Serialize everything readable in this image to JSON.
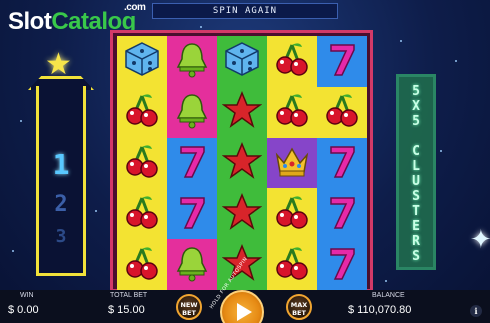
{
  "logo": {
    "slot": "Slot",
    "catalog": "Catalog",
    "com": ".com"
  },
  "banner": {
    "text": "SPIN AGAIN"
  },
  "levels": [
    "1",
    "2",
    "3"
  ],
  "cluster_label": [
    "5",
    "X",
    "5",
    " ",
    "C",
    "L",
    "U",
    "S",
    "T",
    "E",
    "R",
    "S"
  ],
  "grid": [
    [
      {
        "symbol": "dice-icon",
        "bg": "yellow"
      },
      {
        "symbol": "bell-icon",
        "bg": "pink"
      },
      {
        "symbol": "dice-icon",
        "bg": "green"
      },
      {
        "symbol": "cherry-icon",
        "bg": "yellow"
      },
      {
        "symbol": "seven-icon",
        "bg": "blue"
      }
    ],
    [
      {
        "symbol": "cherry-icon",
        "bg": "yellow"
      },
      {
        "symbol": "bell-icon",
        "bg": "pink"
      },
      {
        "symbol": "star-icon",
        "bg": "green"
      },
      {
        "symbol": "cherry-icon",
        "bg": "yellow"
      },
      {
        "symbol": "cherry-icon",
        "bg": "yellow"
      }
    ],
    [
      {
        "symbol": "cherry-icon",
        "bg": "yellow"
      },
      {
        "symbol": "seven-icon",
        "bg": "blue"
      },
      {
        "symbol": "star-icon",
        "bg": "green"
      },
      {
        "symbol": "crown-icon",
        "bg": "purple"
      },
      {
        "symbol": "seven-icon",
        "bg": "blue"
      }
    ],
    [
      {
        "symbol": "cherry-icon",
        "bg": "yellow"
      },
      {
        "symbol": "seven-icon",
        "bg": "blue"
      },
      {
        "symbol": "star-icon",
        "bg": "green"
      },
      {
        "symbol": "cherry-icon",
        "bg": "yellow"
      },
      {
        "symbol": "seven-icon",
        "bg": "blue"
      }
    ],
    [
      {
        "symbol": "cherry-icon",
        "bg": "yellow"
      },
      {
        "symbol": "bell-icon",
        "bg": "pink"
      },
      {
        "symbol": "star-icon",
        "bg": "green"
      },
      {
        "symbol": "cherry-icon",
        "bg": "yellow"
      },
      {
        "symbol": "seven-icon",
        "bg": "blue"
      }
    ]
  ],
  "bottom": {
    "win_label": "WIN",
    "win_value": "$ 0.00",
    "total_bet_label": "TOTAL BET",
    "total_bet_value": "$ 15.00",
    "new_bet": "NEW BET",
    "autospin": "HOLD FOR AUTOSPIN",
    "max_bet": "MAX BET",
    "balance_label": "BALANCE",
    "balance_value": "$ 110,070.80",
    "info": "i"
  }
}
